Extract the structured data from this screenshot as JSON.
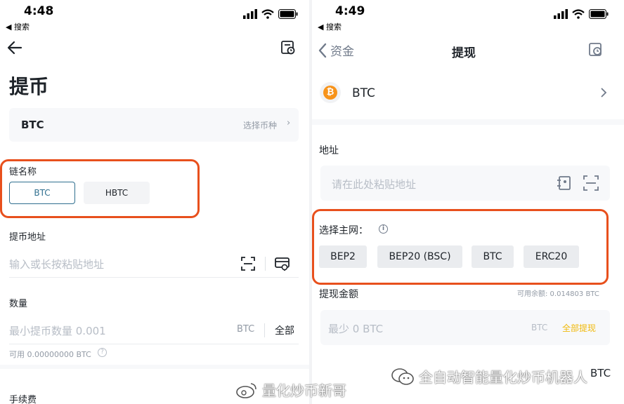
{
  "left": {
    "status": {
      "time": "4:48",
      "back_app": "◀ 搜索"
    },
    "title": "提币",
    "coin": {
      "value": "BTC",
      "select_label": "选择币种"
    },
    "chain": {
      "label": "链名称",
      "options": [
        "BTC",
        "HBTC"
      ],
      "selected": "BTC"
    },
    "address": {
      "label": "提币地址",
      "placeholder": "输入或长按粘贴地址"
    },
    "amount": {
      "label": "数量",
      "placeholder": "最小提币数量 0.001",
      "unit": "BTC",
      "all_label": "全部",
      "available": "可用 0.00000000 BTC"
    },
    "fee": {
      "label": "手续费"
    }
  },
  "right": {
    "status": {
      "time": "4:49",
      "back_app": "◀ 搜索"
    },
    "nav": {
      "back_label": "资金",
      "title": "提现"
    },
    "coin": {
      "name": "BTC"
    },
    "address": {
      "label": "地址",
      "placeholder": "请在此处粘贴地址"
    },
    "network": {
      "label": "选择主网：",
      "options": [
        "BEP2",
        "BEP20 (BSC)",
        "BTC",
        "ERC20"
      ]
    },
    "amount": {
      "label": "提现金额",
      "available": "可用余额: 0.014803 BTC",
      "placeholder": "最少 0 BTC",
      "unit": "BTC",
      "all_label": "全部提现",
      "partial_unit": "BTC"
    }
  },
  "watermarks": {
    "weibo": "量化炒币新哥",
    "wechat": "全自动智能量化炒币机器人"
  },
  "colors": {
    "accent_yellow": "#f0b90b",
    "highlight": "#e8501d",
    "selected_border": "#2f6f8f"
  }
}
